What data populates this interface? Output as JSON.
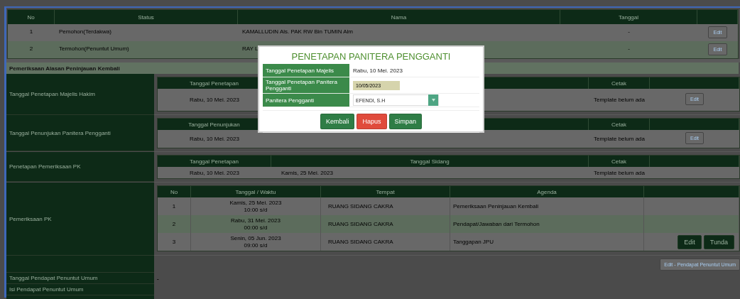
{
  "parties": {
    "columns": [
      "No",
      "Status",
      "Nama",
      "Tanggal"
    ],
    "rows": [
      {
        "no": "1",
        "status": "Pemohon(Terdakwa)",
        "nama": "KAMALLUDIN Als. PAK RW Bin TUMIN Alm",
        "tanggal": "-",
        "action": "Edit"
      },
      {
        "no": "2",
        "status": "Termohon(Penuntut Umum)",
        "nama": "RAY L",
        "tanggal": "-",
        "action": "Edit"
      }
    ]
  },
  "section_title": "Pemeriksaan Alasan Peninjauan Kembali",
  "sections": [
    {
      "label": "Tanggal Penetapan Majelis Hakim",
      "head_1": "Tanggal Penetapan",
      "head_3": "Cetak",
      "cell_1": "Rabu, 10 Mei. 2023",
      "cell_3": "Template belum ada",
      "action": "Edit"
    },
    {
      "label": "Tanggal Penunjukan Panitera Pengganti",
      "head_1": "Tanggal Penunjukan",
      "head_3": "Cetak",
      "cell_1": "Rabu, 10 Mei. 2023",
      "cell_3": "Template belum ada",
      "action": "Edit"
    },
    {
      "label": "Penetapan Pemeriksaan PK",
      "head_1": "Tanggal Penetapan",
      "head_2": "Tanggal Sidang",
      "head_3": "Cetak",
      "cell_1": "Rabu, 10 Mei. 2023",
      "cell_2": "Kamis, 25 Mei. 2023",
      "cell_3": "Template belum ada"
    }
  ],
  "schedule": {
    "label": "Pemeriksaan PK",
    "columns": [
      "No",
      "Tanggal / Waktu",
      "Tempat",
      "Agenda"
    ],
    "rows": [
      {
        "no": "1",
        "date": "Kamis, 25 Mei. 2023",
        "time": "10:00 s/d",
        "tempat": "RUANG SIDANG CAKRA",
        "agenda": "Pemeriksaan Peninjauan Kembali",
        "actions": []
      },
      {
        "no": "2",
        "date": "Rabu, 31 Mei. 2023",
        "time": "00:00 s/d",
        "tempat": "RUANG SIDANG CAKRA",
        "agenda": "Pendapat/Jawaban dari Termohon",
        "actions": []
      },
      {
        "no": "3",
        "date": "Senin, 05 Jun. 2023",
        "time": "09:00 s/d",
        "tempat": "RUANG SIDANG CAKRA",
        "agenda": "Tanggapan JPU",
        "actions": [
          "Edit",
          "Tunda"
        ]
      }
    ]
  },
  "opinion_button": "Edit - Pendapat Penuntut Umum",
  "opinion_rows": [
    {
      "label": "Tanggal Pendapat Penuntut Umum",
      "value": "-"
    },
    {
      "label": "Isi Pendapat Penuntut Umum"
    }
  ],
  "modal": {
    "title": "PENETAPAN PANITERA PENGGANTI",
    "fields": [
      {
        "kind": "text",
        "label": "Tanggal Penetapan Majelis",
        "value": "Rabu, 10 Mei. 2023"
      },
      {
        "kind": "date",
        "label": "Tanggal Penetapan Panitera Pengganti",
        "value": "10/05/2023"
      },
      {
        "kind": "select",
        "label": "Panitera Pengganti",
        "value": "EFENDI, S.H"
      }
    ],
    "buttons": [
      {
        "kind": "back",
        "label": "Kembali"
      },
      {
        "kind": "delete",
        "label": "Hapus"
      },
      {
        "kind": "save",
        "label": "Simpan"
      }
    ]
  }
}
